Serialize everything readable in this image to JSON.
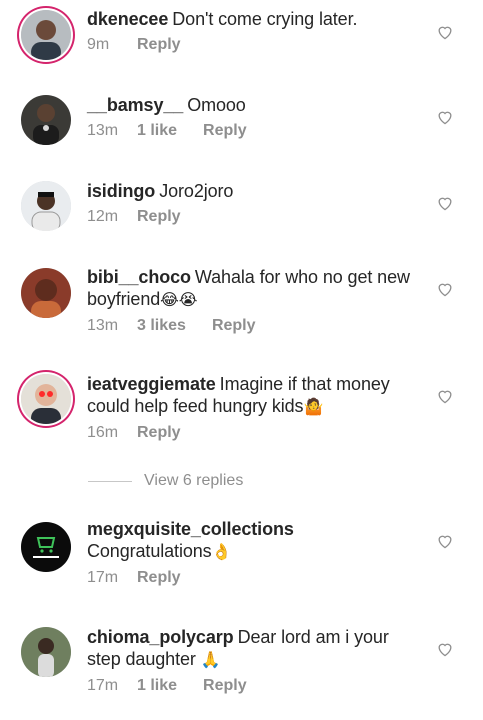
{
  "comments": [
    {
      "username": "dkenecee",
      "text": "Don't come crying later.",
      "time": "9m",
      "likes": "",
      "reply": "Reply"
    },
    {
      "username": "__bamsy__",
      "text": "Omooo",
      "time": "13m",
      "likes": "1 like",
      "reply": "Reply"
    },
    {
      "username": "isidingo",
      "text": "Joro2joro",
      "time": "12m",
      "likes": "",
      "reply": "Reply"
    },
    {
      "username": "bibi__choco",
      "text": "Wahala for who no get new boyfriend",
      "emoji": "😂😭",
      "time": "13m",
      "likes": "3 likes",
      "reply": "Reply"
    },
    {
      "username": "ieatveggiemate",
      "text": "Imagine if that money could help feed hungry kids",
      "emoji": "🤷",
      "time": "16m",
      "likes": "",
      "reply": "Reply"
    },
    {
      "username": "megxquisite_collections",
      "text": "Congratulations",
      "emoji": "👌",
      "time": "17m",
      "likes": "",
      "reply": "Reply"
    },
    {
      "username": "chioma_polycarp",
      "text": "Dear lord am i your step daughter",
      "emoji": "🙏",
      "time": "17m",
      "likes": "1 like",
      "reply": "Reply"
    }
  ],
  "view_replies": "View 6 replies",
  "icons": {
    "like": "heart-outline-icon"
  },
  "colors": {
    "text": "#262626",
    "meta": "#8e8e8e",
    "story_ring": "#d4246c"
  }
}
